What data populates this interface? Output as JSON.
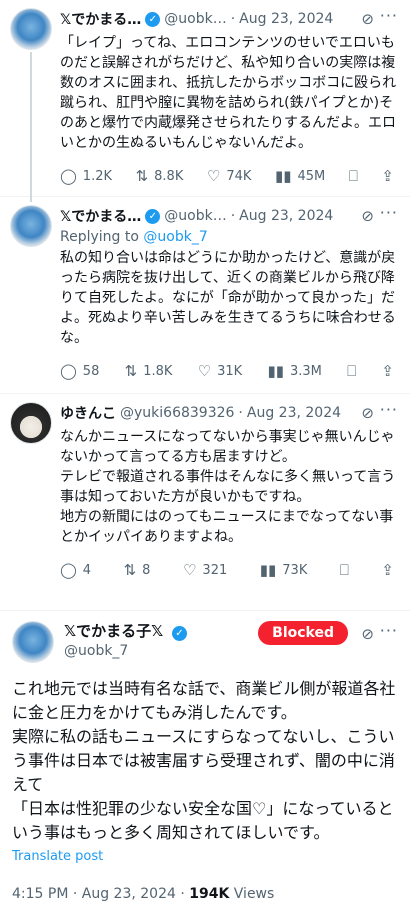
{
  "tweets": [
    {
      "name": "𝕏でかまる…",
      "handle": "@uobk…",
      "date": "Aug 23, 2024",
      "replying": "",
      "body": "「レイプ」ってね、エロコンテンツのせいでエロいものだと誤解されがちだけど、私や知り合いの実際は複数のオスに囲まれ、抵抗したからボッコボコに殴られ蹴られ、肛門や膣に異物を詰められ(鉄パイプとか)そのあと爆竹で内蔵爆発させられたりするんだよ。エロいとかの生ぬるいもんじゃないんだよ。",
      "replies": "1.2K",
      "reposts": "8.8K",
      "likes": "74K",
      "views": "45M"
    },
    {
      "name": "𝕏でかまる…",
      "handle": "@uobk…",
      "date": "Aug 23, 2024",
      "replying_prefix": "Replying to",
      "replying": "@uobk_7",
      "body": "私の知り合いは命はどうにか助かったけど、意識が戻ったら病院を抜け出して、近くの商業ビルから飛び降りて自死したよ。なにが「命が助かって良かった」だよ。死ぬより辛い苦しみを生きてるうちに味合わせるな。",
      "replies": "58",
      "reposts": "1.8K",
      "likes": "31K",
      "views": "3.3M"
    },
    {
      "name": "ゆきんこ",
      "handle": "@yuki66839326",
      "date": "Aug 23, 2024",
      "replying": "",
      "body": "なんかニュースになってないから事実じゃ無いんじゃないかって言ってる方も居ますけど。\nテレビで報道される事件はそんなに多く無いって言う事は知っておいた方が良いかもですね。\n地方の新聞にはのってもニュースにまでなってない事とかイッパイありますよね。",
      "replies": "4",
      "reposts": "8",
      "likes": "321",
      "views": "73K"
    }
  ],
  "main": {
    "name": "𝕏でかまる子𝕏",
    "handle": "@uobk_7",
    "blocked_label": "Blocked",
    "body": "これ地元では当時有名な話で、商業ビル側が報道各社に金と圧力をかけてもみ消したんです。\n実際に私の話もニュースにすらなってないし、こういう事件は日本では被害届すら受理されず、闇の中に消えて\n「日本は性犯罪の少ない安全な国♡」になっているという事はもっと多く周知されてほしいです。",
    "translate": "Translate post",
    "time": "4:15 PM · Aug 23, 2024 · ",
    "views_count": "194K",
    "views_label": " Views"
  },
  "icons": {
    "reply": "reply-icon",
    "repost": "repost-icon",
    "like": "like-icon",
    "views": "views-icon",
    "bookmark": "bookmark-icon",
    "share": "share-icon",
    "grok": "grok-icon",
    "more": "more-icon",
    "verified": "verified-badge-icon"
  },
  "colors": {
    "accent": "#1d9bf0",
    "blocked": "#f4212e",
    "muted": "#536471"
  }
}
